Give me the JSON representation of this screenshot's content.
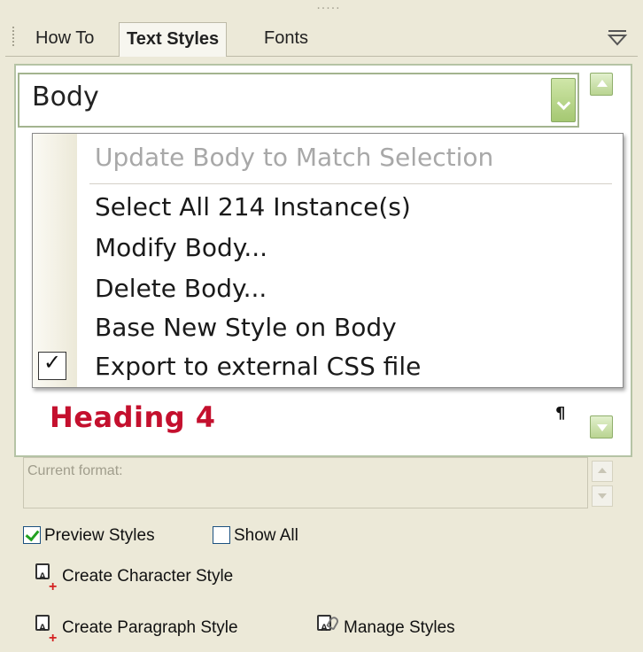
{
  "tabs": [
    {
      "label": "How To",
      "active": false
    },
    {
      "label": "Text Styles",
      "active": true
    },
    {
      "label": "Fonts",
      "active": false
    }
  ],
  "style_select": {
    "value": "Body"
  },
  "context_menu": {
    "items": [
      {
        "label": "Update Body to Match Selection",
        "enabled": false,
        "checked": false
      },
      {
        "label": "Select All 214 Instance(s)",
        "enabled": true,
        "checked": false
      },
      {
        "label": "Modify Body...",
        "enabled": true,
        "checked": false
      },
      {
        "label": "Delete Body...",
        "enabled": true,
        "checked": false
      },
      {
        "label": "Base New Style on Body",
        "enabled": true,
        "checked": false
      },
      {
        "label": "Export to external CSS file",
        "enabled": true,
        "checked": true
      }
    ],
    "check_glyph": "✓"
  },
  "style_list": {
    "heading4_label": "Heading 4",
    "pilcrow": "¶"
  },
  "current_format": {
    "label": "Current format:"
  },
  "options": {
    "preview_styles": {
      "label": "Preview Styles",
      "checked": true
    },
    "show_all": {
      "label": "Show All",
      "checked": false
    }
  },
  "actions": {
    "create_character_style": "Create Character Style",
    "create_paragraph_style": "Create Paragraph Style",
    "manage_styles": "Manage Styles"
  },
  "colors": {
    "heading4": "#c4102e",
    "accent_green": "#a5c872",
    "check_green": "#21a121"
  }
}
